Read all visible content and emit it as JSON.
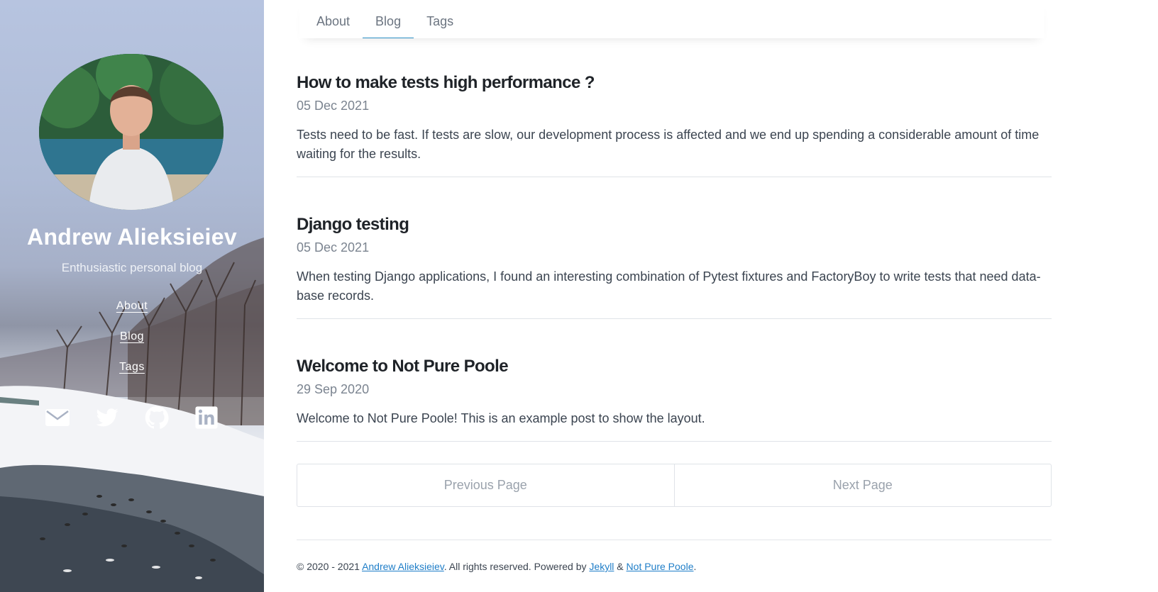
{
  "sidebar": {
    "name": "Andrew Alieksieiev",
    "tagline": "Enthusiastic personal blog",
    "nav": [
      {
        "label": "About"
      },
      {
        "label": "Blog"
      },
      {
        "label": "Tags"
      }
    ],
    "social_icons": [
      "email-icon",
      "twitter-icon",
      "github-icon",
      "linkedin-icon"
    ]
  },
  "topnav": {
    "tabs": [
      {
        "label": "About"
      },
      {
        "label": "Blog",
        "active": true
      },
      {
        "label": "Tags"
      }
    ]
  },
  "posts": [
    {
      "title": "How to make tests high performance ?",
      "date": "05 Dec 2021",
      "excerpt": "Tests need to be fast. If tests are slow, our development process is affected and we end up spending a considerable amount of time waiting for the results."
    },
    {
      "title": "Django testing",
      "date": "05 Dec 2021",
      "excerpt": "When testing Django applications, I found an interesting combination of Pytest fixtures and FactoryBoy to write tests that need data­base records."
    },
    {
      "title": "Welcome to Not Pure Poole",
      "date": "29 Sep 2020",
      "excerpt": "Welcome to Not Pure Poole! This is an example post to show the layout."
    }
  ],
  "pagination": {
    "previous_label": "Previous Page",
    "next_label": "Next Page"
  },
  "footer": {
    "prefix": "© 2020 - 2021 ",
    "author_link": "Andrew Alieksieiev",
    "middle": ". All rights reserved. Powered by ",
    "jekyll_link": "Jekyll",
    "amp": " & ",
    "theme_link": "Not Pure Poole",
    "suffix": "."
  },
  "colors": {
    "accent": "#2a8fc4",
    "link": "#1f7ec8",
    "title": "#1f2328",
    "muted": "#7b8490"
  }
}
